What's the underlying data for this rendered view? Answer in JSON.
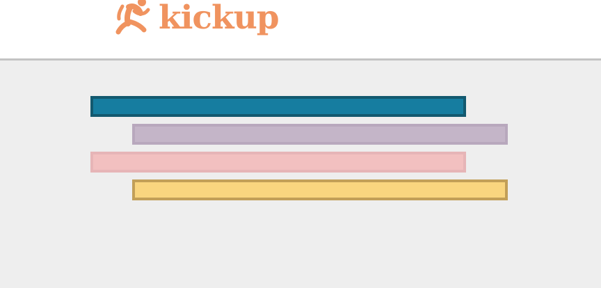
{
  "brand": {
    "name": "kickup",
    "color": "#f0935f",
    "logo_icon": "running-figure-icon"
  },
  "colors": {
    "header_background": "#ffffff",
    "divider": "#c3c3c3",
    "content_background": "#eeeeee"
  },
  "loading_bars": [
    {
      "name": "teal",
      "fill": "#167da0",
      "border": "#13596f"
    },
    {
      "name": "lavender",
      "fill": "#c4b5c8",
      "border": "#b8a8bd"
    },
    {
      "name": "pink",
      "fill": "#f2c0c0",
      "border": "#e6b5b7"
    },
    {
      "name": "yellow",
      "fill": "#f9d57f",
      "border": "#c29f58"
    }
  ]
}
